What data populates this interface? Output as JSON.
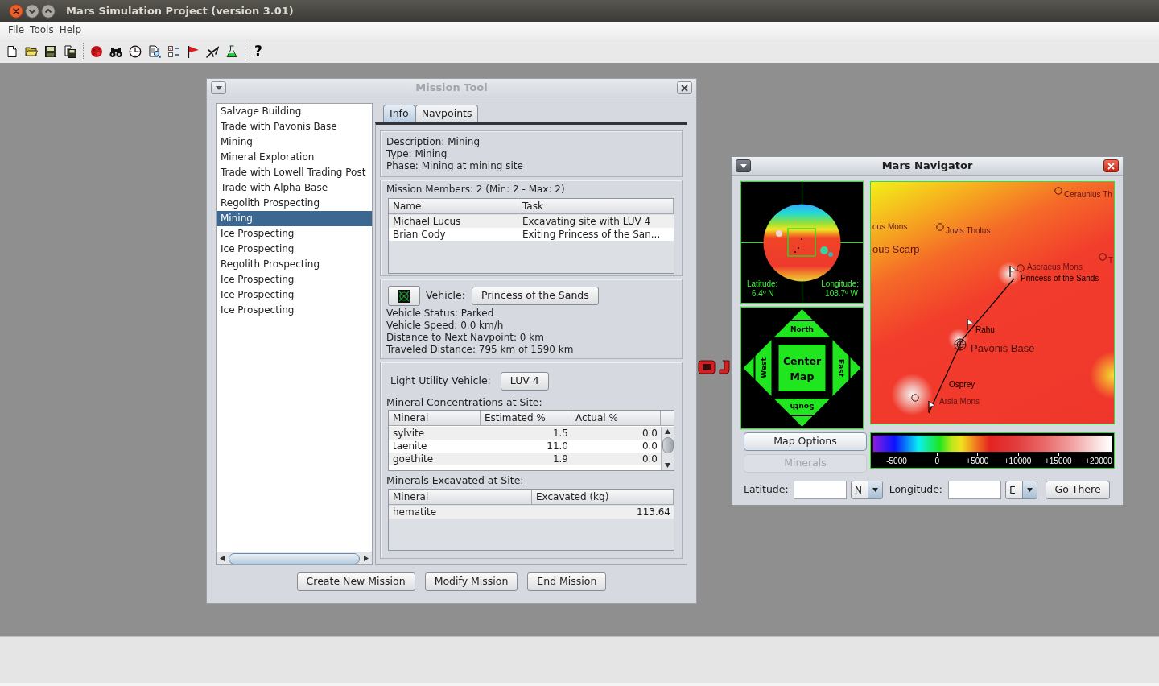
{
  "window": {
    "title": "Mars Simulation Project (version 3.01)"
  },
  "menu": [
    "File",
    "Tools",
    "Help"
  ],
  "toolbar": {
    "help_button": "?"
  },
  "mission_tool": {
    "title": "Mission Tool",
    "active": false,
    "missions": [
      {
        "label": "Salvage Building",
        "selected": false
      },
      {
        "label": "Trade with Pavonis Base",
        "selected": false
      },
      {
        "label": "Mining",
        "selected": false
      },
      {
        "label": "Mineral Exploration",
        "selected": false
      },
      {
        "label": "Trade with Lowell Trading Post",
        "selected": false
      },
      {
        "label": "Trade with Alpha Base",
        "selected": false
      },
      {
        "label": "Regolith Prospecting",
        "selected": false
      },
      {
        "label": "Mining",
        "selected": true
      },
      {
        "label": "Ice Prospecting",
        "selected": false
      },
      {
        "label": "Ice Prospecting",
        "selected": false
      },
      {
        "label": "Regolith Prospecting",
        "selected": false
      },
      {
        "label": "Ice Prospecting",
        "selected": false
      },
      {
        "label": "Ice Prospecting",
        "selected": false
      },
      {
        "label": "Ice Prospecting",
        "selected": false
      }
    ],
    "tabs": [
      {
        "label": "Info",
        "selected": true
      },
      {
        "label": "Navpoints",
        "selected": false
      }
    ],
    "description": [
      "Description: Mining",
      "Type: Mining",
      "Phase: Mining at mining site"
    ],
    "members": {
      "heading": "Mission Members: 2 (Min: 2 - Max: 2)",
      "columns": [
        "Name",
        "Task"
      ],
      "rows": [
        [
          "Michael Lucus",
          "Excavating site with LUV 4"
        ],
        [
          "Brian Cody",
          "Exiting Princess of the San..."
        ]
      ]
    },
    "vehicle": {
      "label": "Vehicle:",
      "button": "Princess of the Sands",
      "details": [
        "Vehicle Status: Parked",
        "Vehicle Speed: 0.0 km/h",
        "Distance to Next Navpoint: 0 km",
        "Traveled Distance: 795 km of 1590 km"
      ]
    },
    "mining": {
      "luv_label": "Light Utility Vehicle:",
      "luv_button": "LUV 4",
      "concentrations_heading": "Mineral Concentrations at Site:",
      "concentrations": {
        "columns": [
          "Mineral",
          "Estimated %",
          "Actual %"
        ],
        "rows": [
          [
            "sylvite",
            "1.5",
            "0.0"
          ],
          [
            "taenite",
            "11.0",
            "0.0"
          ],
          [
            "goethite",
            "1.9",
            "0.0"
          ]
        ]
      },
      "excavated_heading": "Minerals Excavated at Site:",
      "excavated": {
        "columns": [
          "Mineral",
          "Excavated (kg)"
        ],
        "rows": [
          [
            "hematite",
            "113.64"
          ]
        ]
      }
    },
    "buttons": [
      "Create New Mission",
      "Modify Mission",
      "End Mission"
    ]
  },
  "navigator": {
    "title": "Mars Navigator",
    "active": true,
    "globe": {
      "latitude_label": "Latitude:",
      "latitude": "6.4º N",
      "longitude_label": "Longitude:",
      "longitude": "108.7º W"
    },
    "compass": {
      "north": "North",
      "west": "West",
      "east": "East",
      "south": "South",
      "center": [
        "Center",
        "Map"
      ]
    },
    "map_labels": [
      {
        "text": "Ceraunius Th",
        "kind": "landmark"
      },
      {
        "text": "ous Mons",
        "kind": "label"
      },
      {
        "text": "Jovis Tholus",
        "kind": "landmark"
      },
      {
        "text": "ous Scarp",
        "kind": "region"
      },
      {
        "text": "T",
        "kind": "landmark"
      },
      {
        "text": "Ascraeus Mons",
        "kind": "landmark"
      },
      {
        "text": "Princess of the Sands",
        "kind": "vehicle"
      },
      {
        "text": "Rahu",
        "kind": "navpoint"
      },
      {
        "text": "Pavonis Base",
        "kind": "settlement"
      },
      {
        "text": "Osprey",
        "kind": "navpoint"
      },
      {
        "text": "Arsia Mons",
        "kind": "landmark"
      }
    ],
    "buttons": [
      {
        "label": "Map Options",
        "disabled": false
      },
      {
        "label": "Minerals",
        "disabled": true
      }
    ],
    "legend": {
      "ticks": [
        "-5000",
        "0",
        "+5000",
        "+10000",
        "+15000",
        "+20000"
      ]
    },
    "goto": {
      "latitude_label": "Latitude:",
      "latitude_direction": "N",
      "longitude_label": "Longitude:",
      "longitude_direction": "E",
      "button": "Go There"
    }
  }
}
